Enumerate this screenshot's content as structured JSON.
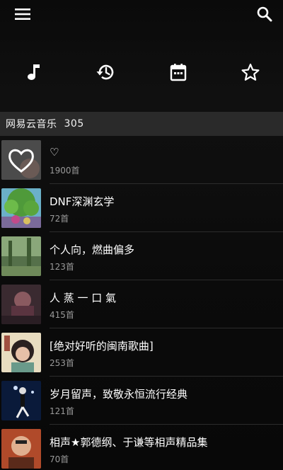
{
  "header": {
    "menu_icon": "menu-icon",
    "search_icon": "search-icon"
  },
  "tabs": [
    {
      "icon": "music-note-icon"
    },
    {
      "icon": "history-icon"
    },
    {
      "icon": "calendar-icon"
    },
    {
      "icon": "star-icon"
    }
  ],
  "section": {
    "title": "网易云音乐",
    "count": "305"
  },
  "playlists": [
    {
      "title": "♡",
      "count": "1900首"
    },
    {
      "title": "DNF深渊玄学",
      "count": "72首"
    },
    {
      "title": "个人向，燃曲偏多",
      "count": "123首"
    },
    {
      "title": "人 蒸 一 口 氣",
      "count": "415首"
    },
    {
      "title": "[绝对好听的闽南歌曲]",
      "count": "253首"
    },
    {
      "title": "岁月留声，致敬永恒流行经典",
      "count": "121首"
    },
    {
      "title": "相声★郭德纲、于谦等相声精品集",
      "count": "70首"
    }
  ],
  "colors": {
    "background": "#0b0b0b",
    "section_bar": "#2a2a2a",
    "subtext": "#9a9a9a"
  }
}
